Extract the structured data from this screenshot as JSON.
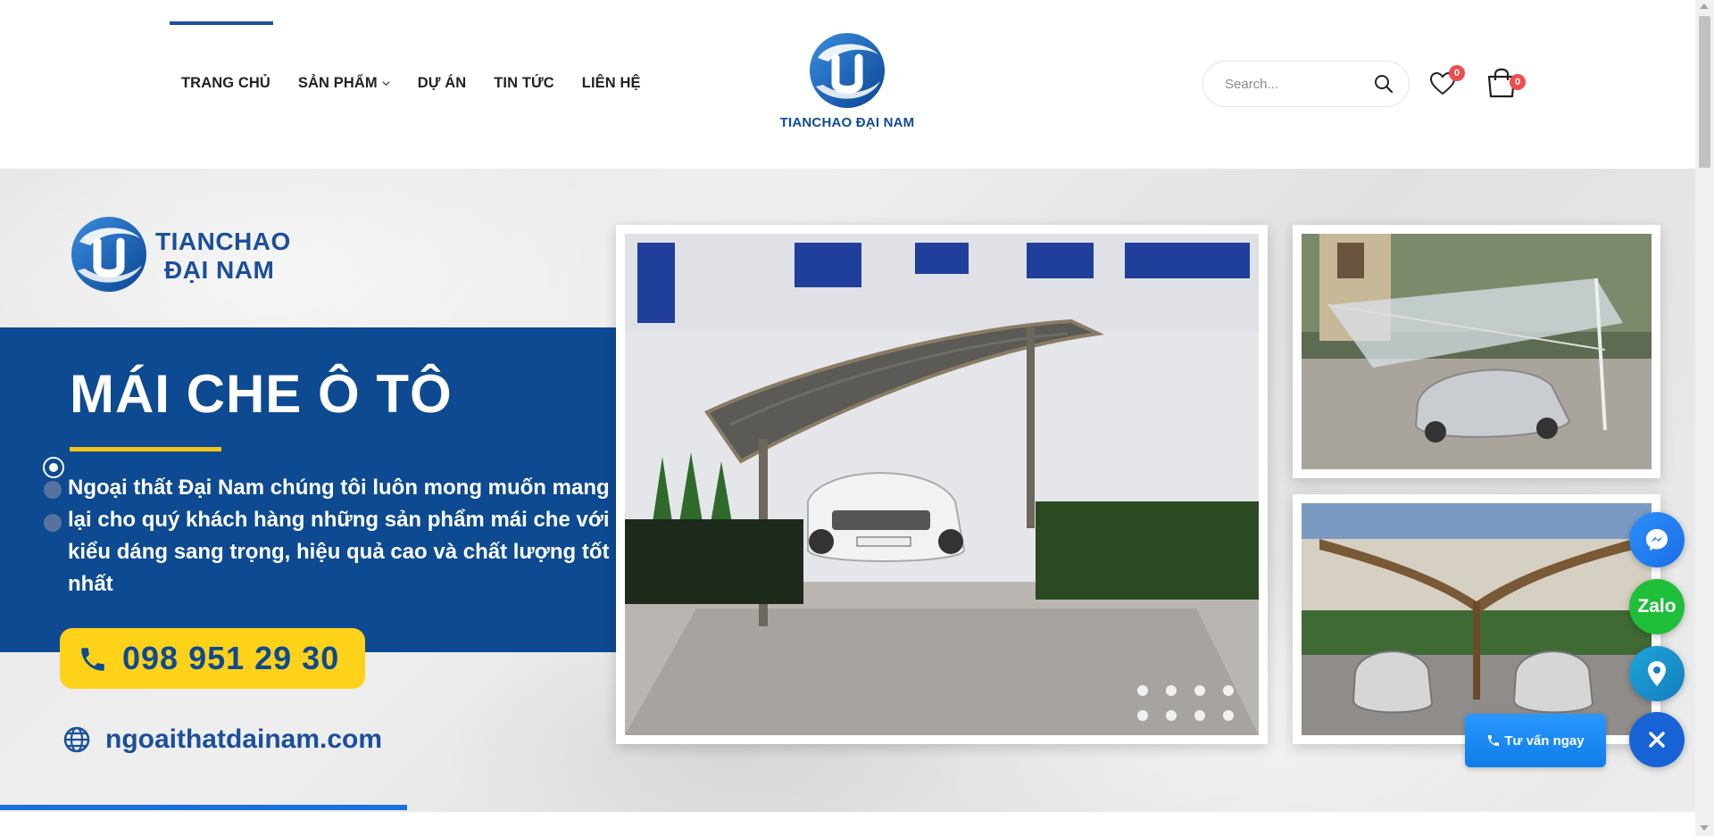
{
  "header": {
    "nav": [
      {
        "label": "TRANG CHỦ"
      },
      {
        "label": "SẢN PHẨM",
        "has_dropdown": true
      },
      {
        "label": "DỰ ÁN"
      },
      {
        "label": "TIN TỨC"
      },
      {
        "label": "LIÊN HỆ"
      }
    ],
    "logo_text": "TIANCHAO ĐẠI NAM",
    "search_placeholder": "Search...",
    "wishlist_count": "0",
    "cart_count": "0"
  },
  "hero": {
    "brand_line1": "TIANCHAO",
    "brand_line2": "ĐẠI NAM",
    "title": "MÁI CHE Ô TÔ",
    "description": "Ngoại thất Đại Nam chúng tôi luôn mong muốn mang lại cho quý khách hàng những sản phẩm mái che với kiểu dáng sang trọng, hiệu quả cao và chất lượng tốt nhất",
    "phone": "098 951 29 30",
    "website": "ngoaithatdainam.com",
    "slide_progress": 0.24
  },
  "floating": {
    "zalo_label": "Zalo",
    "consult_label": "Tư vấn ngay"
  },
  "colors": {
    "brand_blue": "#0d4a92",
    "accent_yellow": "#ffd21a",
    "badge_red": "#ef4d4d",
    "zalo_green": "#1fbf3a"
  },
  "icons": [
    "search-icon",
    "heart-icon",
    "cart-icon",
    "phone-icon",
    "globe-icon",
    "messenger-icon",
    "map-pin-icon",
    "close-icon"
  ]
}
